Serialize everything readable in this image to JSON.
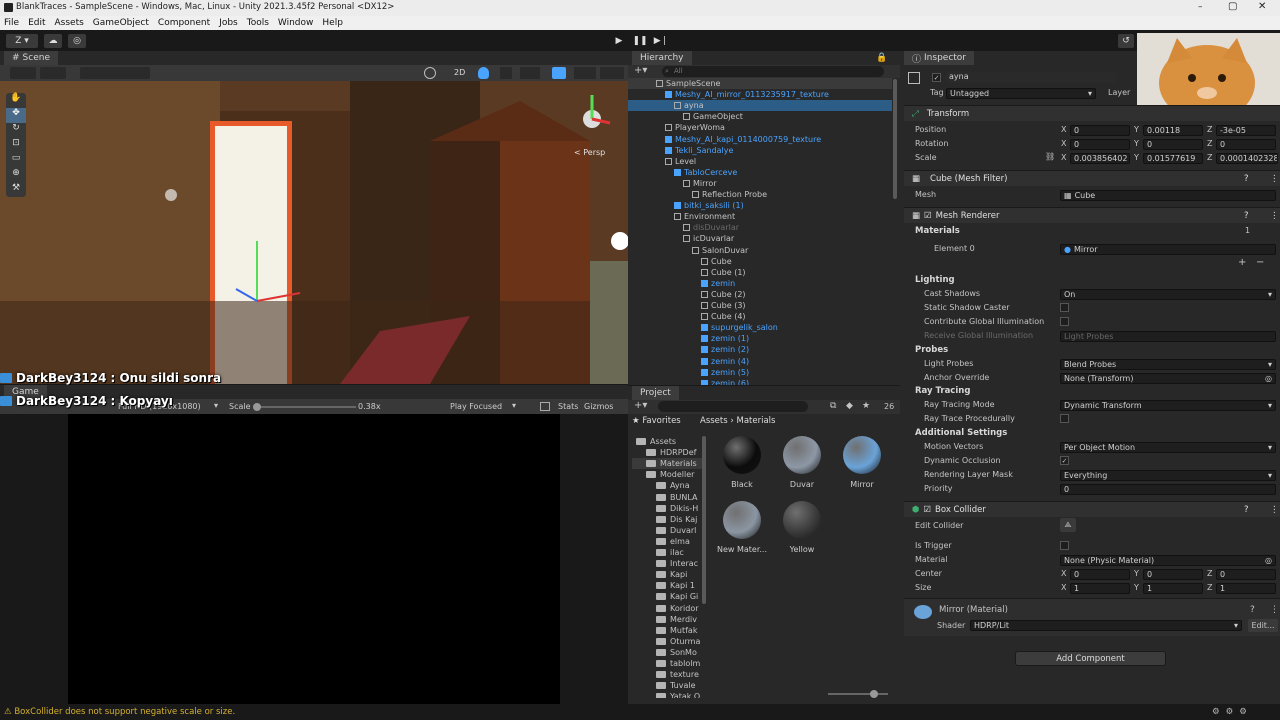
{
  "window": {
    "title": "BlankTraces - SampleScene - Windows, Mac, Linux - Unity 2021.3.45f2 Personal <DX12>",
    "controls": [
      "–",
      "▢",
      "✕"
    ]
  },
  "menu": [
    "File",
    "Edit",
    "Assets",
    "GameObject",
    "Component",
    "Jobs",
    "Tools",
    "Window",
    "Help"
  ],
  "toolbar": {
    "account": "Z"
  },
  "scene": {
    "tab": "Scene",
    "mode_2d": "2D",
    "persp_label": "< Persp"
  },
  "chat": [
    {
      "user": "DarkBey3124",
      "message": ": Onu sildi sonra"
    },
    {
      "user": "DarkBey3124",
      "message": ": Kopyayı"
    }
  ],
  "game": {
    "tab": "Game",
    "resolution": "Full HD (1920x1080)",
    "scale_label": "Scale",
    "scale_value": "0.38x",
    "play_mode": "Play Focused",
    "stats": "Stats",
    "gizmos": "Gizmos"
  },
  "hierarchy": {
    "tab": "Hierarchy",
    "search_placeholder": "All",
    "items": [
      {
        "label": "SampleScene",
        "depth": 0,
        "style": "scene"
      },
      {
        "label": "Meshy_AI_mirror_0113235917_texture",
        "depth": 1,
        "style": "blue"
      },
      {
        "label": "ayna",
        "depth": 2,
        "style": "selected"
      },
      {
        "label": "GameObject",
        "depth": 3,
        "style": "normal"
      },
      {
        "label": "PlayerWoma",
        "depth": 1,
        "style": "normal"
      },
      {
        "label": "Meshy_AI_kapi_0114000759_texture",
        "depth": 1,
        "style": "blue"
      },
      {
        "label": "Tekli_Sandalye",
        "depth": 1,
        "style": "blue"
      },
      {
        "label": "Level",
        "depth": 1,
        "style": "normal"
      },
      {
        "label": "TabloCerceve",
        "depth": 2,
        "style": "blue"
      },
      {
        "label": "Mirror",
        "depth": 3,
        "style": "normal"
      },
      {
        "label": "Reflection Probe",
        "depth": 4,
        "style": "normal"
      },
      {
        "label": "bitki_saksili (1)",
        "depth": 2,
        "style": "blue"
      },
      {
        "label": "Environment",
        "depth": 2,
        "style": "normal"
      },
      {
        "label": "disDuvarlar",
        "depth": 3,
        "style": "dim"
      },
      {
        "label": "icDuvarlar",
        "depth": 3,
        "style": "normal"
      },
      {
        "label": "SalonDuvar",
        "depth": 4,
        "style": "normal"
      },
      {
        "label": "Cube",
        "depth": 5,
        "style": "normal"
      },
      {
        "label": "Cube (1)",
        "depth": 5,
        "style": "normal"
      },
      {
        "label": "zemin",
        "depth": 5,
        "style": "blue"
      },
      {
        "label": "Cube (2)",
        "depth": 5,
        "style": "normal"
      },
      {
        "label": "Cube (3)",
        "depth": 5,
        "style": "normal"
      },
      {
        "label": "Cube (4)",
        "depth": 5,
        "style": "normal"
      },
      {
        "label": "supurgelik_salon",
        "depth": 5,
        "style": "blue"
      },
      {
        "label": "zemin (1)",
        "depth": 5,
        "style": "blue"
      },
      {
        "label": "zemin (2)",
        "depth": 5,
        "style": "blue"
      },
      {
        "label": "zemin (4)",
        "depth": 5,
        "style": "blue"
      },
      {
        "label": "zemin (5)",
        "depth": 5,
        "style": "blue"
      },
      {
        "label": "zemin (6)",
        "depth": 5,
        "style": "blue"
      }
    ]
  },
  "project": {
    "tab": "Project",
    "favorites": "Favorites",
    "count": "26",
    "breadcrumb_root": "Assets",
    "breadcrumb_sep": "›",
    "breadcrumb_current": "Materials",
    "tree": [
      "Assets",
      "HDRPDef",
      "Materials",
      "Modeller",
      "Ayna",
      "BUNLA",
      "Dikis-H",
      "Dis Kaj",
      "Duvarl",
      "elma",
      "ilac",
      "Interac",
      "Kapi",
      "Kapi 1",
      "Kapi Gi",
      "Koridor",
      "Merdiv",
      "Mutfak",
      "Oturma",
      "SonMo",
      "tablolm",
      "texture",
      "Tuvale",
      "Yatak O"
    ],
    "materials": [
      {
        "name": "Black",
        "color": "#0c0c0c"
      },
      {
        "name": "Duvar",
        "color": "#8d98a6"
      },
      {
        "name": "Mirror",
        "color": "#6aa3d8"
      },
      {
        "name": "New Mater...",
        "color": "#8b96a3"
      },
      {
        "name": "Yellow",
        "color": "#3a3a3a"
      }
    ]
  },
  "inspector": {
    "tab": "Inspector",
    "object_name": "ayna",
    "tag_label": "Tag",
    "tag_value": "Untagged",
    "layer_label": "Layer",
    "transform": {
      "title": "Transform",
      "position_label": "Position",
      "position": {
        "x": "0",
        "y": "0.00118",
        "z": "-3e-05"
      },
      "rotation_label": "Rotation",
      "rotation": {
        "x": "0",
        "y": "0",
        "z": "0"
      },
      "scale_label": "Scale",
      "scale": {
        "x": "0.003856402",
        "y": "0.01577619",
        "z": "0.0001402328"
      }
    },
    "mesh_filter": {
      "title": "Cube (Mesh Filter)",
      "mesh_label": "Mesh",
      "mesh_value": "Cube"
    },
    "mesh_renderer": {
      "title": "Mesh Renderer",
      "materials_label": "Materials",
      "materials_count": "1",
      "element0_label": "Element 0",
      "element0_value": "Mirror",
      "lighting": "Lighting",
      "cast_shadows_label": "Cast Shadows",
      "cast_shadows_value": "On",
      "static_shadow_label": "Static Shadow Caster",
      "contribute_gi_label": "Contribute Global Illumination",
      "receive_gi_label": "Receive Global Illumination",
      "receive_gi_value": "Light Probes",
      "probes": "Probes",
      "light_probes_label": "Light Probes",
      "light_probes_value": "Blend Probes",
      "anchor_override_label": "Anchor Override",
      "anchor_override_value": "None (Transform)",
      "ray_tracing": "Ray Tracing",
      "ray_tracing_mode_label": "Ray Tracing Mode",
      "ray_tracing_mode_value": "Dynamic Transform",
      "ray_trace_proc_label": "Ray Trace Procedurally",
      "additional_settings": "Additional Settings",
      "motion_vectors_label": "Motion Vectors",
      "motion_vectors_value": "Per Object Motion",
      "dynamic_occlusion_label": "Dynamic Occlusion",
      "rendering_layer_mask_label": "Rendering Layer Mask",
      "rendering_layer_mask_value": "Everything",
      "priority_label": "Priority",
      "priority_value": "0"
    },
    "box_collider": {
      "title": "Box Collider",
      "edit_collider_label": "Edit Collider",
      "is_trigger_label": "Is Trigger",
      "material_label": "Material",
      "material_value": "None (Physic Material)",
      "center_label": "Center",
      "center": {
        "x": "0",
        "y": "0",
        "z": "0"
      },
      "size_label": "Size",
      "size": {
        "x": "1",
        "y": "1",
        "z": "1"
      }
    },
    "material_block": {
      "title": "Mirror (Material)",
      "shader_label": "Shader",
      "shader_value": "HDRP/Lit",
      "edit_button": "Edit..."
    },
    "add_component": "Add Component",
    "axis": {
      "x": "X",
      "y": "Y",
      "z": "Z"
    }
  },
  "status": {
    "message": "BoxCollider does not support negative scale or size."
  },
  "colors": {
    "accent_blue": "#4aa3ff",
    "selection": "#2c5d87",
    "warning": "#d5b12f"
  }
}
